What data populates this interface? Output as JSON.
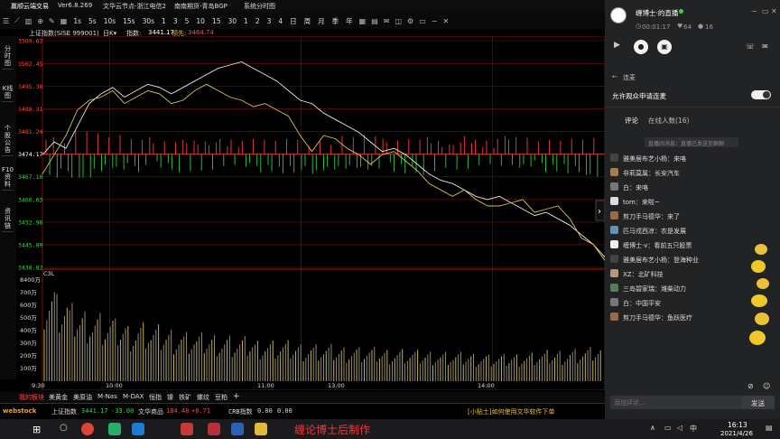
{
  "app": {
    "title_items": [
      "赢顺云端交易",
      "Ver6.8.269",
      "文华云节点-浙江电信2",
      "南南期货-青岛BGP",
      "系统分时图"
    ]
  },
  "toolbar": {
    "intervals": [
      "1s",
      "5s",
      "10s",
      "15s",
      "30s",
      "1",
      "3",
      "5",
      "10",
      "15",
      "30",
      "1",
      "2",
      "3",
      "4",
      "日",
      "周",
      "月",
      "季",
      "年"
    ]
  },
  "left_tabs": [
    "分时图",
    "K线图",
    "个股公告",
    "F10资料",
    "资讯链"
  ],
  "chart_header": {
    "name": "上证指数(SISE 999001)",
    "mode": "日K▾",
    "index_label": "指数:",
    "index_value": "3441.17",
    "lead_label": "领先:",
    "lead_value": "3464.74"
  },
  "chart_data": {
    "type": "line",
    "price_ticks": [
      "3509.62",
      "3502.45",
      "3495.38",
      "3488.31",
      "3481.24",
      "3474.17",
      "3467.10",
      "3460.03",
      "3452.96",
      "3445.89",
      "3438.82"
    ],
    "ylim": [
      3438.82,
      3509.62
    ],
    "reference_price": 3474.17,
    "x_labels": [
      "9:30",
      "10:00",
      "11:00",
      "13:00",
      "14:00"
    ],
    "series": [
      {
        "values": [
          3474,
          3478,
          3476,
          3483,
          3490,
          3493,
          3495,
          3492,
          3494,
          3496,
          3495,
          3493,
          3495,
          3497,
          3499,
          3501,
          3502,
          3503,
          3501,
          3499,
          3497,
          3494,
          3491,
          3490,
          3487,
          3485,
          3483,
          3481,
          3478,
          3475,
          3476,
          3474,
          3471,
          3468,
          3466,
          3465,
          3463,
          3461,
          3460,
          3461,
          3459,
          3457,
          3455,
          3456,
          3454,
          3452,
          3449,
          3446,
          3442
        ]
      },
      {
        "values": [
          3468,
          3474,
          3480,
          3488,
          3491,
          3492,
          3494,
          3490,
          3492,
          3494,
          3493,
          3490,
          3491,
          3494,
          3496,
          3494,
          3492,
          3491,
          3489,
          3490,
          3488,
          3486,
          3480,
          3475,
          3480,
          3479,
          3476,
          3474,
          3471,
          3474,
          3475,
          3472,
          3469,
          3465,
          3463,
          3461,
          3463,
          3460,
          3458,
          3458,
          3459,
          3460,
          3456,
          3457,
          3458,
          3454,
          3448,
          3446,
          3441
        ]
      }
    ],
    "volume_ticks": [
      "8400万",
      "700万",
      "600万",
      "500万",
      "400万",
      "300万",
      "200万",
      "100万"
    ],
    "volume_label": "C3L",
    "volume_values": [
      520,
      460,
      400,
      380,
      360,
      340,
      320,
      300,
      310,
      290,
      280,
      270,
      260,
      250,
      250,
      240,
      230,
      230,
      220,
      215,
      210,
      205,
      200,
      195,
      190,
      185,
      185,
      180,
      175,
      170,
      170,
      165,
      160,
      160,
      155,
      150,
      150,
      145,
      140,
      140,
      145,
      150,
      155,
      160,
      165,
      170,
      175,
      185,
      200
    ]
  },
  "bottom_tabs": [
    "我的板块",
    "美黄金",
    "美原油",
    "M-Nas",
    "M-DAX",
    "恒指",
    "镍",
    "铁矿",
    "螺纹",
    "豆粕",
    "+"
  ],
  "status": {
    "logo": "webstock",
    "index_name": "上证指数",
    "index_value": "3441.17",
    "index_change": "-33.00",
    "commodity_name": "文华商品",
    "commodity_value": "184.48",
    "commodity_change": "+0.71",
    "crb_name": "CRB指数",
    "crb_value": "0.00",
    "crb_change": "0.00",
    "tip": "[小贴士]如何使用文华软件下单"
  },
  "live": {
    "host_name": "缠博士·的直播",
    "duration": "00:01:17",
    "likes": "64",
    "viewers": "16",
    "section_title": "连麦",
    "allow_label": "允许观众申请连麦",
    "tab_comments": "评论",
    "tab_online": "在线人数(16)",
    "system_msg": "直播间消息：直播已发送至群聊",
    "comments": [
      "雅美居布艺小杨：来咯",
      "非莉莫属：长安汽车",
      "白：来咯",
      "tom：来啦~",
      "剪刀手马德华：来了",
      "匹马戎西凉：农是发展",
      "缠博士·v：看前五只股票",
      "雅美居布艺小杨：登海种业",
      "XZ：北矿科技",
      "三岛碧家瑞：潍柴动力",
      "白：中国平安",
      "剪刀手马德华：鱼跃医疗"
    ],
    "input_placeholder": "添加评论...",
    "send_label": "发送"
  },
  "watermark": "缠论博士后制作",
  "taskbar": {
    "time": "16:13",
    "date": "2021/4/26",
    "ime": "中"
  }
}
